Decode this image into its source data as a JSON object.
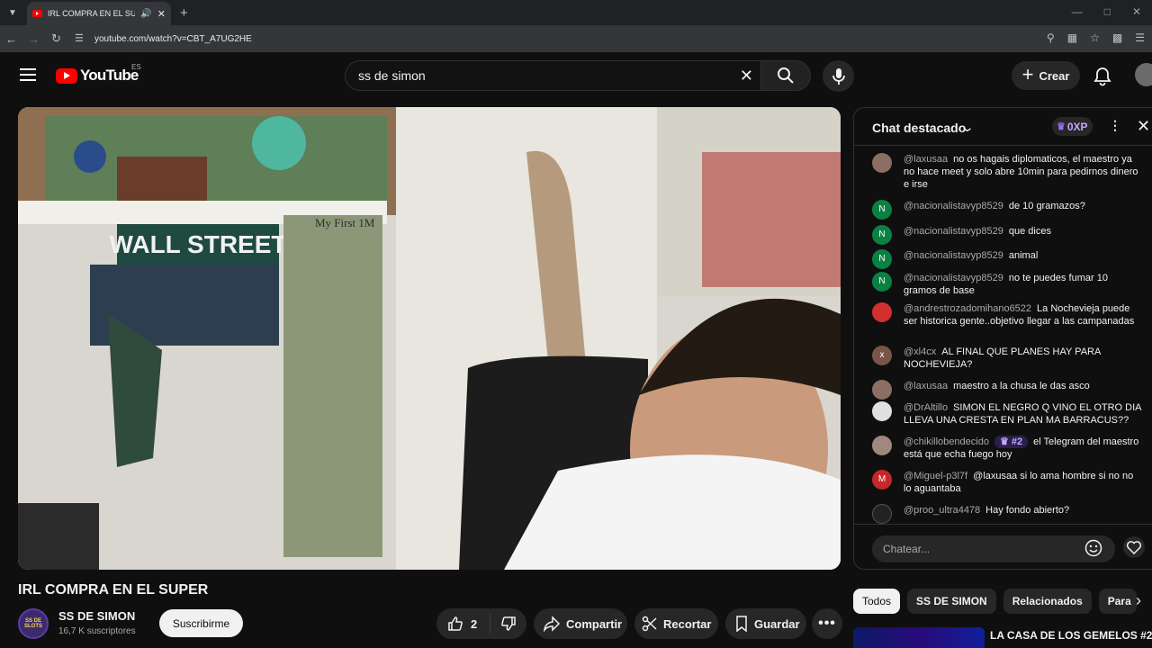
{
  "browser": {
    "tab_title": "IRL COMPRA EN EL SUPER",
    "url": "youtube.com/watch?v=CBT_A7UG2HE"
  },
  "header": {
    "logo_text": "YouTube",
    "region": "ES",
    "search_value": "ss de simon",
    "create_label": "Crear"
  },
  "video": {
    "title": "IRL COMPRA EN EL SUPER",
    "scene_text": {
      "sign": "WALL STREET",
      "frame": "My First 1M"
    }
  },
  "channel": {
    "name": "SS DE SIMON",
    "subscribers": "16,7 K suscriptores",
    "subscribe_label": "Suscribirme",
    "avatar_text": "SS DE SLOTS"
  },
  "actions": {
    "likes": "2",
    "share": "Compartir",
    "clip": "Recortar",
    "save": "Guardar"
  },
  "chat": {
    "title": "Chat destacado",
    "xp": "0XP",
    "input_placeholder": "Chatear...",
    "messages": [
      {
        "author": "@laxusaa",
        "text": "no os hagais diplomaticos, el maestro ya no hace meet y solo abre 10min para pedirnos dinero e irse",
        "avatar_letter": "",
        "avatar_color": "#8d6e63"
      },
      {
        "author": "@nacionalistavyp8529",
        "text": "de 10 gramazos?",
        "avatar_letter": "N",
        "avatar_color": "#0b8043"
      },
      {
        "author": "@nacionalistavyp8529",
        "text": "que dices",
        "avatar_letter": "N",
        "avatar_color": "#0b8043"
      },
      {
        "author": "@nacionalistavyp8529",
        "text": "animal",
        "avatar_letter": "N",
        "avatar_color": "#0b8043"
      },
      {
        "author": "@nacionalistavyp8529",
        "text": "no te puedes fumar 10 gramos de base",
        "avatar_letter": "N",
        "avatar_color": "#0b8043"
      },
      {
        "author": "@andrestrozadomihano6522",
        "text": "La Nochevieja puede ser historica gente..objetivo llegar a las campanadas",
        "avatar_letter": "",
        "avatar_color": "#d32f2f"
      },
      {
        "author": "@xl4cx",
        "text": "AL FINAL QUE PLANES HAY PARA NOCHEVIEJA?",
        "avatar_letter": "x",
        "avatar_color": "#795548"
      },
      {
        "author": "@laxusaa",
        "text": "maestro a la chusa le das asco",
        "avatar_letter": "",
        "avatar_color": "#8d6e63"
      },
      {
        "author": "@DrAltillo",
        "text": "SIMON EL NEGRO Q VINO EL OTRO DIA LLEVA UNA CRESTA EN PLAN MA BARRACUS??",
        "avatar_letter": "",
        "avatar_color": "#e0e0e0"
      },
      {
        "author": "@chikillobendecido",
        "badge": "#2",
        "text": "el Telegram del maestro está que echa fuego hoy",
        "avatar_letter": "",
        "avatar_color": "#a1887f"
      },
      {
        "author": "@Miguel-p3l7f",
        "text": "@laxusaa si lo ama hombre si no no lo aguantaba",
        "avatar_letter": "M",
        "avatar_color": "#c62828"
      },
      {
        "author": "@proo_ultra4478",
        "text": "Hay fondo abierto?",
        "avatar_letter": "",
        "avatar_color": "#222222"
      }
    ]
  },
  "chips": [
    "Todos",
    "SS DE SIMON",
    "Relacionados",
    "Para"
  ],
  "recommendation": {
    "title": "LA CASA DE LOS GEMELOS #2 |"
  },
  "colors": {
    "background": "#0f0f0f",
    "brand_red": "#ff0000",
    "chat_badge": "#9b6bff"
  }
}
